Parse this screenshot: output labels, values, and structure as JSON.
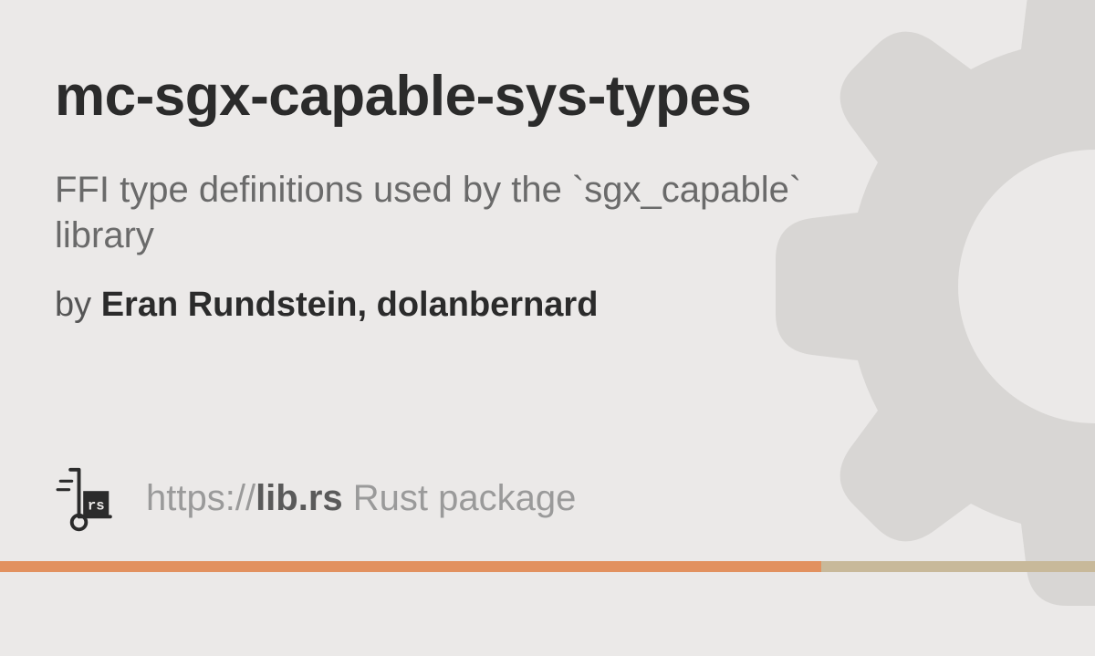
{
  "package": {
    "name": "mc-sgx-capable-sys-types",
    "description": "FFI type definitions used by the `sgx_capable` library",
    "by_label": "by ",
    "authors": "Eran Rundstein, dolanbernard"
  },
  "footer": {
    "url_prefix": "https://",
    "domain": "lib.rs",
    "suffix": " Rust package"
  }
}
